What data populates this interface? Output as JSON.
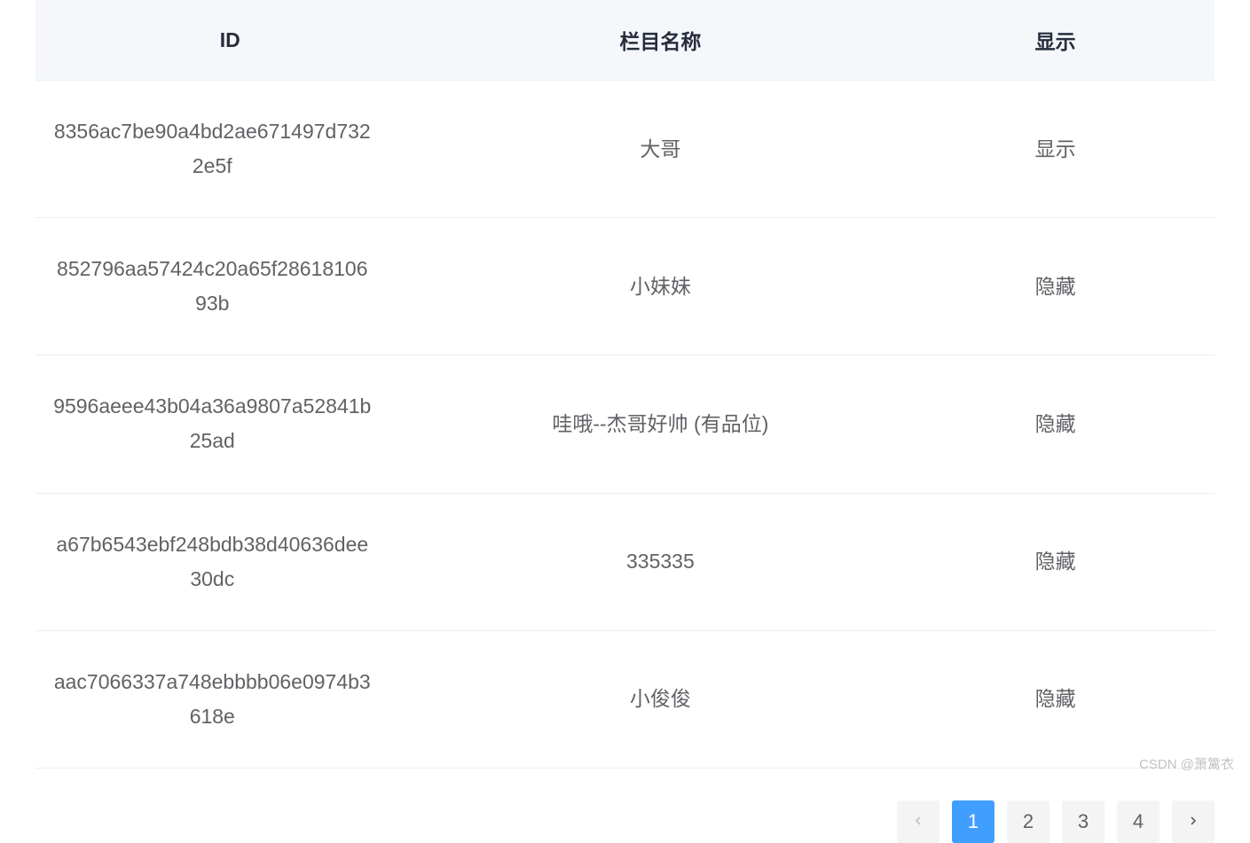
{
  "table": {
    "headers": {
      "id": "ID",
      "name": "栏目名称",
      "display": "显示"
    },
    "rows": [
      {
        "id": "8356ac7be90a4bd2ae671497d7322e5f",
        "name": "大哥",
        "display": "显示"
      },
      {
        "id": "852796aa57424c20a65f2861810693b",
        "name": "小妹妹",
        "display": "隐藏"
      },
      {
        "id": "9596aeee43b04a36a9807a52841b25ad",
        "name": "哇哦--杰哥好帅 (有品位)",
        "display": "隐藏"
      },
      {
        "id": "a67b6543ebf248bdb38d40636dee30dc",
        "name": "335335",
        "display": "隐藏"
      },
      {
        "id": "aac7066337a748ebbbb06e0974b3618e",
        "name": "小俊俊",
        "display": "隐藏"
      }
    ]
  },
  "pagination": {
    "pages": [
      "1",
      "2",
      "3",
      "4"
    ],
    "current": "1"
  },
  "watermark": "CSDN @萧篱衣"
}
